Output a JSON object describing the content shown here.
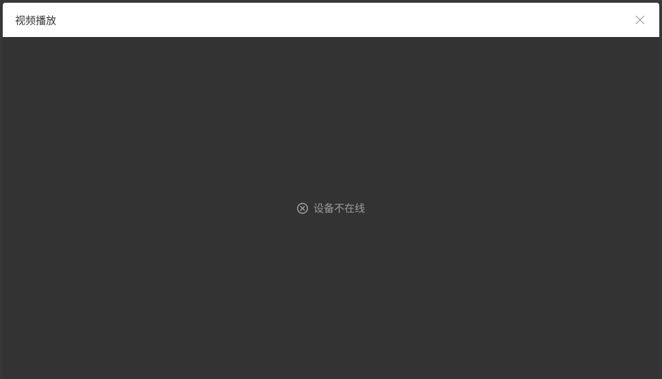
{
  "modal": {
    "title": "视频播放",
    "status_message": "设备不在线"
  }
}
